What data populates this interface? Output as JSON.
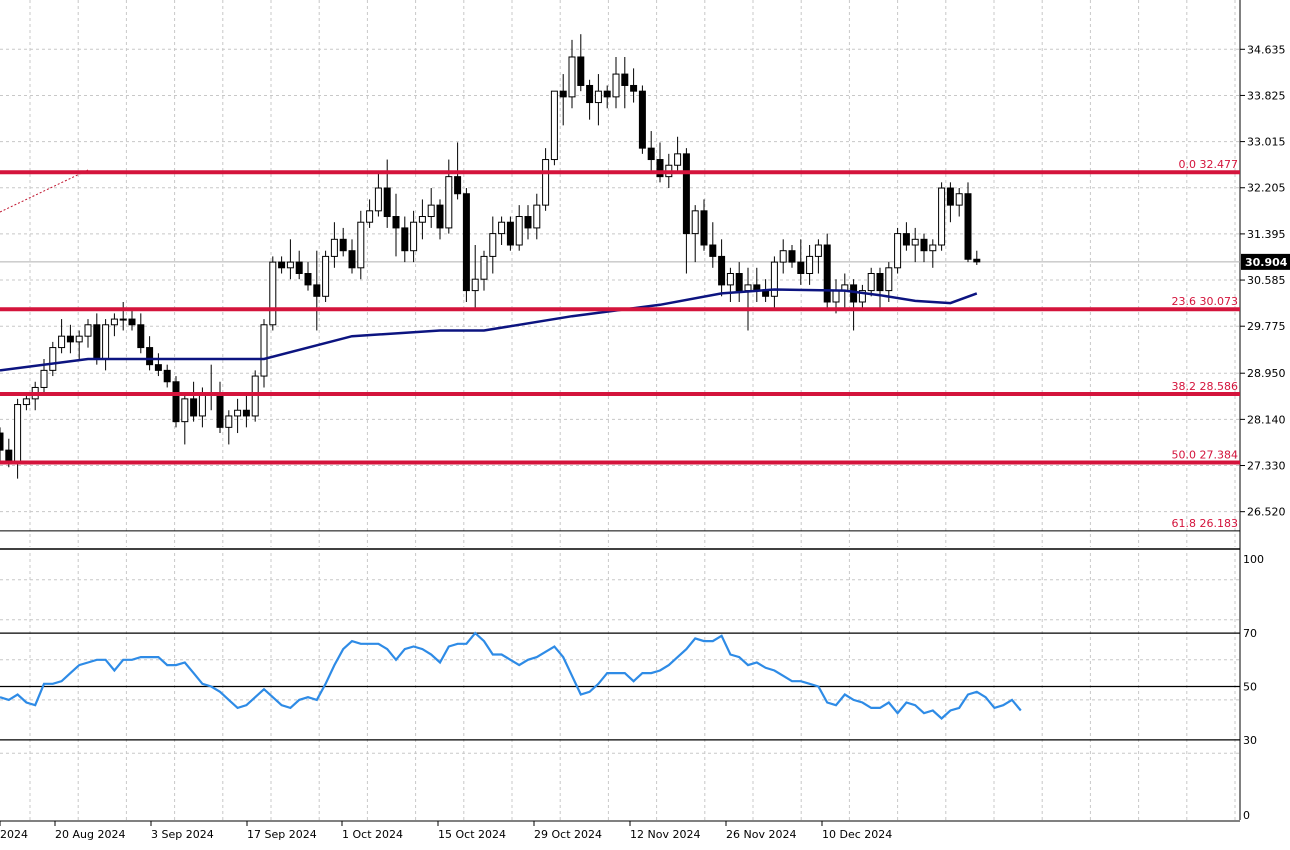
{
  "chart_data": [
    {
      "type": "candlestick",
      "title": "",
      "ylim": [
        25.9,
        35.5
      ],
      "y_ticks": [
        "34.635",
        "33.825",
        "33.015",
        "32.205",
        "31.395",
        "30.585",
        "29.775",
        "28.950",
        "28.140",
        "27.330",
        "26.520"
      ],
      "last_price": "30.904",
      "grid": true,
      "x_ticks": [
        "2024",
        "20 Aug 2024",
        "3 Sep 2024",
        "17 Sep 2024",
        "1 Oct 2024",
        "15 Oct 2024",
        "29 Oct 2024",
        "12 Nov 2024",
        "26 Nov 2024",
        "10 Dec 2024"
      ],
      "fib_levels": [
        {
          "label": "0.0 32.477",
          "value": 32.477
        },
        {
          "label": "23.6 30.073",
          "value": 30.073
        },
        {
          "label": "38.2 28.586",
          "value": 28.586
        },
        {
          "label": "50.0 27.384",
          "value": 27.384
        },
        {
          "label": "61.8 26.183",
          "value": 26.183
        }
      ],
      "candles": [
        [
          27.9,
          28.0,
          27.4,
          27.6
        ],
        [
          27.6,
          27.8,
          27.3,
          27.4
        ],
        [
          27.4,
          28.5,
          27.1,
          28.4
        ],
        [
          28.4,
          28.6,
          28.3,
          28.5
        ],
        [
          28.5,
          28.8,
          28.3,
          28.7
        ],
        [
          28.7,
          29.2,
          28.6,
          29.0
        ],
        [
          29.0,
          29.5,
          28.9,
          29.4
        ],
        [
          29.4,
          29.9,
          29.3,
          29.6
        ],
        [
          29.6,
          29.8,
          29.3,
          29.5
        ],
        [
          29.5,
          29.7,
          29.2,
          29.6
        ],
        [
          29.6,
          29.9,
          29.4,
          29.8
        ],
        [
          29.8,
          30.0,
          29.1,
          29.2
        ],
        [
          29.2,
          29.9,
          29.0,
          29.8
        ],
        [
          29.8,
          30.0,
          29.6,
          29.9
        ],
        [
          29.9,
          30.2,
          29.7,
          29.9
        ],
        [
          29.9,
          30.1,
          29.7,
          29.8
        ],
        [
          29.8,
          30.0,
          29.3,
          29.4
        ],
        [
          29.4,
          29.6,
          29.0,
          29.1
        ],
        [
          29.1,
          29.3,
          28.9,
          29.0
        ],
        [
          29.0,
          29.1,
          28.7,
          28.8
        ],
        [
          28.8,
          28.9,
          28.0,
          28.1
        ],
        [
          28.1,
          28.6,
          27.7,
          28.5
        ],
        [
          28.5,
          28.8,
          28.1,
          28.2
        ],
        [
          28.2,
          28.7,
          28.0,
          28.6
        ],
        [
          28.6,
          29.1,
          28.3,
          28.6
        ],
        [
          28.6,
          28.8,
          27.9,
          28.0
        ],
        [
          28.0,
          28.3,
          27.7,
          28.2
        ],
        [
          28.2,
          28.5,
          27.9,
          28.3
        ],
        [
          28.3,
          28.6,
          28.0,
          28.2
        ],
        [
          28.2,
          29.0,
          28.1,
          28.9
        ],
        [
          28.9,
          29.9,
          28.7,
          29.8
        ],
        [
          29.8,
          31.0,
          29.7,
          30.9
        ],
        [
          30.9,
          31.0,
          30.7,
          30.8
        ],
        [
          30.8,
          31.3,
          30.6,
          30.9
        ],
        [
          30.9,
          31.1,
          30.6,
          30.7
        ],
        [
          30.7,
          30.9,
          30.4,
          30.5
        ],
        [
          30.5,
          31.1,
          29.7,
          30.3
        ],
        [
          30.3,
          31.1,
          30.2,
          31.0
        ],
        [
          31.0,
          31.6,
          30.8,
          31.3
        ],
        [
          31.3,
          31.5,
          31.0,
          31.1
        ],
        [
          31.1,
          31.3,
          30.7,
          30.8
        ],
        [
          30.8,
          31.8,
          30.6,
          31.6
        ],
        [
          31.6,
          32.0,
          31.5,
          31.8
        ],
        [
          31.8,
          32.5,
          31.7,
          32.2
        ],
        [
          32.2,
          32.7,
          31.5,
          31.7
        ],
        [
          31.7,
          32.1,
          31.0,
          31.5
        ],
        [
          31.5,
          31.7,
          30.9,
          31.1
        ],
        [
          31.1,
          31.8,
          30.9,
          31.6
        ],
        [
          31.6,
          32.0,
          31.3,
          31.7
        ],
        [
          31.7,
          32.2,
          31.5,
          31.9
        ],
        [
          31.9,
          32.0,
          31.3,
          31.5
        ],
        [
          31.5,
          32.7,
          31.4,
          32.4
        ],
        [
          32.4,
          33.0,
          32.0,
          32.1
        ],
        [
          32.1,
          32.2,
          30.2,
          30.4
        ],
        [
          30.4,
          31.2,
          30.1,
          30.6
        ],
        [
          30.6,
          31.1,
          30.4,
          31.0
        ],
        [
          31.0,
          31.7,
          30.7,
          31.4
        ],
        [
          31.4,
          31.7,
          31.2,
          31.6
        ],
        [
          31.6,
          31.7,
          31.1,
          31.2
        ],
        [
          31.2,
          31.9,
          31.1,
          31.7
        ],
        [
          31.7,
          31.9,
          31.3,
          31.5
        ],
        [
          31.5,
          32.1,
          31.3,
          31.9
        ],
        [
          31.9,
          32.9,
          31.8,
          32.7
        ],
        [
          32.7,
          33.9,
          32.6,
          33.9
        ],
        [
          33.9,
          34.2,
          33.3,
          33.8
        ],
        [
          33.8,
          34.8,
          33.6,
          34.5
        ],
        [
          34.5,
          34.9,
          33.9,
          34.0
        ],
        [
          34.0,
          34.1,
          33.4,
          33.7
        ],
        [
          33.7,
          34.2,
          33.3,
          33.9
        ],
        [
          33.9,
          34.0,
          33.6,
          33.8
        ],
        [
          33.8,
          34.5,
          33.6,
          34.2
        ],
        [
          34.2,
          34.5,
          33.6,
          34.0
        ],
        [
          34.0,
          34.3,
          33.7,
          33.9
        ],
        [
          33.9,
          34.0,
          32.8,
          32.9
        ],
        [
          32.9,
          33.2,
          32.5,
          32.7
        ],
        [
          32.7,
          33.0,
          32.3,
          32.4
        ],
        [
          32.4,
          32.8,
          32.2,
          32.6
        ],
        [
          32.6,
          33.1,
          32.5,
          32.8
        ],
        [
          32.8,
          32.9,
          30.7,
          31.4
        ],
        [
          31.4,
          31.9,
          30.9,
          31.8
        ],
        [
          31.8,
          32.0,
          31.1,
          31.2
        ],
        [
          31.2,
          31.6,
          30.8,
          31.0
        ],
        [
          31.0,
          31.3,
          30.3,
          30.5
        ],
        [
          30.5,
          30.8,
          30.2,
          30.7
        ],
        [
          30.7,
          30.9,
          30.2,
          30.4
        ],
        [
          30.4,
          30.8,
          29.7,
          30.5
        ],
        [
          30.5,
          30.8,
          30.2,
          30.4
        ],
        [
          30.4,
          30.6,
          30.2,
          30.3
        ],
        [
          30.3,
          31.0,
          30.1,
          30.9
        ],
        [
          30.9,
          31.3,
          30.7,
          31.1
        ],
        [
          31.1,
          31.2,
          30.8,
          30.9
        ],
        [
          30.9,
          31.3,
          30.5,
          30.7
        ],
        [
          30.7,
          31.2,
          30.5,
          31.0
        ],
        [
          31.0,
          31.3,
          30.7,
          31.2
        ],
        [
          31.2,
          31.4,
          30.1,
          30.2
        ],
        [
          30.2,
          30.6,
          30.0,
          30.4
        ],
        [
          30.4,
          30.7,
          30.1,
          30.5
        ],
        [
          30.5,
          30.6,
          29.7,
          30.2
        ],
        [
          30.2,
          30.5,
          30.1,
          30.4
        ],
        [
          30.4,
          30.8,
          30.3,
          30.7
        ],
        [
          30.7,
          30.8,
          30.1,
          30.4
        ],
        [
          30.4,
          30.9,
          30.2,
          30.8
        ],
        [
          30.8,
          31.5,
          30.7,
          31.4
        ],
        [
          31.4,
          31.6,
          31.1,
          31.2
        ],
        [
          31.2,
          31.5,
          30.9,
          31.3
        ],
        [
          31.3,
          31.4,
          30.9,
          31.1
        ],
        [
          31.1,
          31.3,
          30.8,
          31.2
        ],
        [
          31.2,
          32.3,
          31.1,
          32.2
        ],
        [
          32.2,
          32.3,
          31.6,
          31.9
        ],
        [
          31.9,
          32.2,
          31.7,
          32.1
        ],
        [
          32.1,
          32.3,
          30.9,
          30.95
        ],
        [
          30.95,
          31.1,
          30.85,
          30.904
        ]
      ],
      "moving_average": {
        "color": "#0c1480",
        "points": [
          [
            0,
            29.0
          ],
          [
            10,
            29.2
          ],
          [
            20,
            29.2
          ],
          [
            30,
            29.2
          ],
          [
            40,
            29.6
          ],
          [
            50,
            29.7
          ],
          [
            55,
            29.7
          ],
          [
            65,
            29.95
          ],
          [
            75,
            30.15
          ],
          [
            82,
            30.35
          ],
          [
            88,
            30.42
          ],
          [
            96,
            30.4
          ],
          [
            100,
            30.32
          ],
          [
            104,
            30.22
          ],
          [
            108,
            30.18
          ],
          [
            111,
            30.35
          ]
        ]
      },
      "trend_line_color": "#c0142e",
      "fib_color": "#d4143c"
    },
    {
      "type": "line",
      "title": "",
      "ylim": [
        0,
        100
      ],
      "y_ticks": [
        "100",
        "0"
      ],
      "levels": [
        {
          "label": "70",
          "value": 70
        },
        {
          "label": "50",
          "value": 50
        },
        {
          "label": "30",
          "value": 30
        }
      ],
      "series": [
        {
          "color": "#2e8be6",
          "values": [
            46,
            45,
            47,
            44,
            43,
            51,
            51,
            52,
            55,
            58,
            59,
            60,
            60,
            56,
            60,
            60,
            61,
            61,
            61,
            58,
            58,
            59,
            55,
            51,
            50,
            48,
            45,
            42,
            43,
            46,
            49,
            46,
            43,
            42,
            45,
            46,
            45,
            51,
            58,
            64,
            67,
            66,
            66,
            66,
            64,
            60,
            64,
            65,
            64,
            62,
            59,
            65,
            66,
            66,
            70,
            67,
            62,
            62,
            60,
            58,
            60,
            61,
            63,
            65,
            61,
            54,
            47,
            48,
            51,
            55,
            55,
            55,
            52,
            55,
            55,
            56,
            58,
            61,
            64,
            68,
            67,
            67,
            69,
            62,
            61,
            58,
            59,
            57,
            56,
            54,
            52,
            52,
            51,
            50,
            44,
            43,
            47,
            45,
            44,
            42,
            42,
            44,
            40,
            44,
            43,
            40,
            41,
            38,
            41,
            42,
            47,
            48,
            46,
            42,
            43,
            45,
            41
          ]
        }
      ]
    }
  ]
}
